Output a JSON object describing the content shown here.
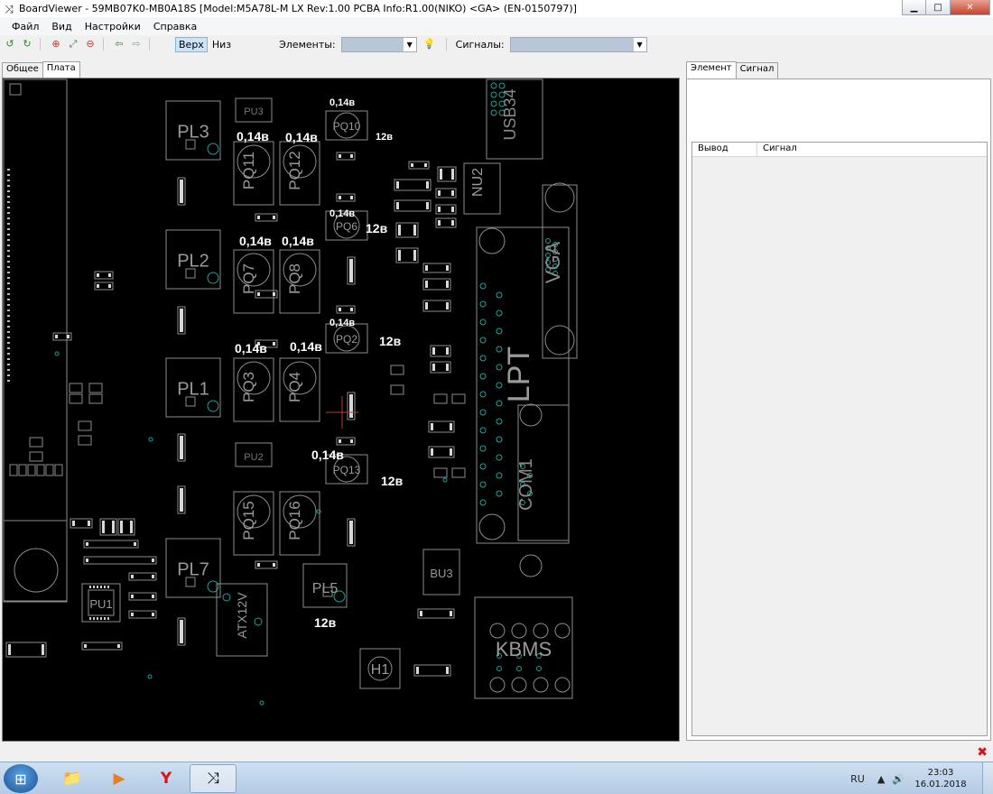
{
  "window": {
    "title": "BoardViewer  -  59MB07K0-MB0A18S [Model:M5A78L-M LX Rev:1.00 PCBA Info:R1.00(NIKO) <GA> (EN-0150797)]",
    "app_icon": "shuffle-icon"
  },
  "menu": [
    "Файл",
    "Вид",
    "Настройки",
    "Справка"
  ],
  "toolbar": {
    "side_top": "Верх",
    "side_bottom": "Низ",
    "elements_label": "Элементы:",
    "signals_label": "Сигналы:"
  },
  "left_tabs": [
    "Общее",
    "Плата"
  ],
  "right_tabs": [
    "Элемент",
    "Сигнал"
  ],
  "table_headers": [
    "Вывод",
    "Сигнал"
  ],
  "board": {
    "components": [
      {
        "label": "PL3"
      },
      {
        "label": "PL2"
      },
      {
        "label": "PL1"
      },
      {
        "label": "PL7"
      },
      {
        "label": "PL5"
      },
      {
        "label": "PQ11"
      },
      {
        "label": "PQ12"
      },
      {
        "label": "PQ7"
      },
      {
        "label": "PQ8"
      },
      {
        "label": "PQ3"
      },
      {
        "label": "PQ4"
      },
      {
        "label": "PQ15"
      },
      {
        "label": "PQ16"
      },
      {
        "label": "PQ10"
      },
      {
        "label": "PQ6"
      },
      {
        "label": "PQ2"
      },
      {
        "label": "PQ13"
      },
      {
        "label": "PU1"
      },
      {
        "label": "PU3"
      },
      {
        "label": "PU2"
      },
      {
        "label": "NU2"
      },
      {
        "label": "BU3"
      },
      {
        "label": "H1"
      },
      {
        "label": "USB34"
      },
      {
        "label": "VGA"
      },
      {
        "label": "LPT"
      },
      {
        "label": "COM1"
      },
      {
        "label": "KBMS"
      },
      {
        "label": "ATX12V"
      }
    ],
    "annotations": [
      {
        "text": "0,14в"
      },
      {
        "text": "0,14в"
      },
      {
        "text": "0,14в"
      },
      {
        "text": "12в"
      },
      {
        "text": "0,14в"
      },
      {
        "text": "0,14в"
      },
      {
        "text": "0,14в"
      },
      {
        "text": "12в"
      },
      {
        "text": "0,14в"
      },
      {
        "text": "0,14в"
      },
      {
        "text": "0,14в"
      },
      {
        "text": "12в"
      },
      {
        "text": "0,14в"
      },
      {
        "text": "12в"
      },
      {
        "text": "12в"
      }
    ]
  },
  "taskbar": {
    "language": "RU",
    "time": "23:03",
    "date": "16.01.2018"
  },
  "colors": {
    "board_bg": "#000000",
    "outline": "#8c8c8c",
    "pad_teal": "#1aa39a",
    "annotation_white": "#ffffff",
    "cursor_red": "#c0392b"
  }
}
